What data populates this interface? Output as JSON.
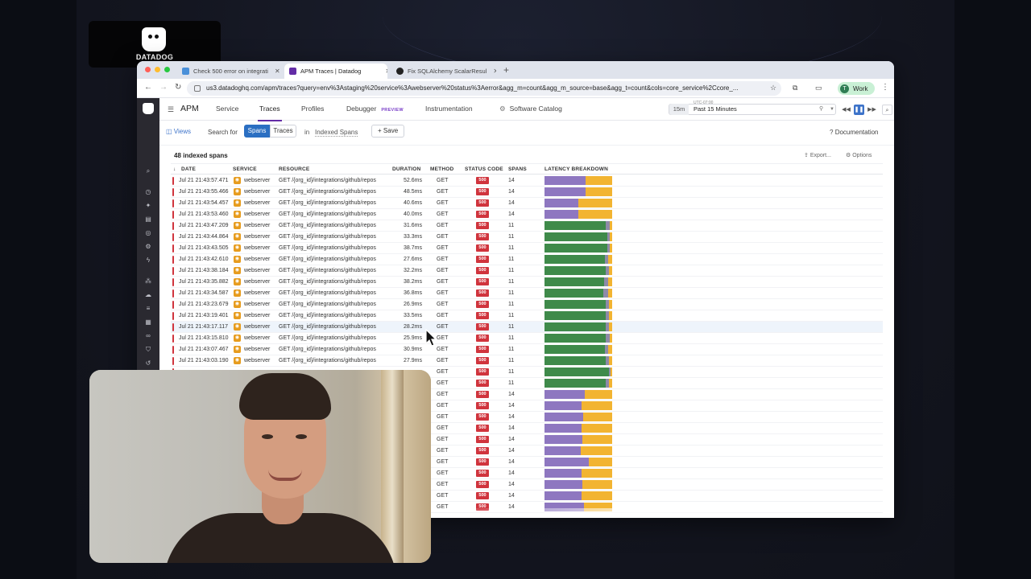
{
  "brand": {
    "logo_text": "DATADOG"
  },
  "browser": {
    "tabs": [
      {
        "title": "Check 500 error on integrati",
        "icon_color": "#4a90d9"
      },
      {
        "title": "APM Traces | Datadog",
        "icon_color": "#632ca6"
      },
      {
        "title": "Fix SQLAlchemy ScalarResul",
        "icon_color": "#222222"
      }
    ],
    "url": "us3.datadoghq.com/apm/traces?query=env%3Astaging%20service%3Awebserver%20status%3Aerror&agg_m=count&agg_m_source=base&agg_t=count&cols=core_service%2Ccore_...",
    "profile_initial": "T",
    "profile_label": "Work"
  },
  "apm": {
    "title": "APM",
    "nav": [
      {
        "label": "Service"
      },
      {
        "label": "Traces"
      },
      {
        "label": "Profiles"
      },
      {
        "label": "Debugger",
        "tag": "PREVIEW"
      },
      {
        "label": "Instrumentation"
      },
      {
        "label": "Software Catalog"
      }
    ],
    "time": {
      "tz": "UTC-07:00",
      "range": "15m",
      "label": "Past 15 Minutes"
    },
    "subbar": {
      "views": "Views",
      "search_for": "Search for",
      "seg_spans": "Spans",
      "seg_traces": "Traces",
      "in": "in",
      "indexed_spans": "Indexed Spans",
      "save": "Save",
      "documentation": "Documentation"
    },
    "count_label": "48 indexed spans",
    "export": "Export...",
    "options": "Options",
    "columns": [
      "DATE",
      "SERVICE",
      "RESOURCE",
      "DURATION",
      "METHOD",
      "STATUS CODE",
      "SPANS",
      "LATENCY BREAKDOWN"
    ],
    "rows": [
      {
        "date": "Jul 21 21:43:57.471",
        "service": "webserver",
        "resource": "GET /{org_id}/integrations/github/repos",
        "duration": "52.6ms",
        "method": "GET",
        "status": "500",
        "spans": "14",
        "latency": [
          0.61,
          0.39,
          0,
          0
        ]
      },
      {
        "date": "Jul 21 21:43:55.466",
        "service": "webserver",
        "resource": "GET /{org_id}/integrations/github/repos",
        "duration": "48.5ms",
        "method": "GET",
        "status": "500",
        "spans": "14",
        "latency": [
          0.61,
          0.39,
          0,
          0
        ]
      },
      {
        "date": "Jul 21 21:43:54.457",
        "service": "webserver",
        "resource": "GET /{org_id}/integrations/github/repos",
        "duration": "40.6ms",
        "method": "GET",
        "status": "500",
        "spans": "14",
        "latency": [
          0.5,
          0.5,
          0,
          0
        ]
      },
      {
        "date": "Jul 21 21:43:53.460",
        "service": "webserver",
        "resource": "GET /{org_id}/integrations/github/repos",
        "duration": "40.0ms",
        "method": "GET",
        "status": "500",
        "spans": "14",
        "latency": [
          0.5,
          0.5,
          0,
          0
        ]
      },
      {
        "date": "Jul 21 21:43:47.209",
        "service": "webserver",
        "resource": "GET /{org_id}/integrations/github/repos",
        "duration": "31.6ms",
        "method": "GET",
        "status": "500",
        "spans": "11",
        "latency": [
          0.91,
          0.05,
          0.04,
          0
        ]
      },
      {
        "date": "Jul 21 21:43:44.864",
        "service": "webserver",
        "resource": "GET /{org_id}/integrations/github/repos",
        "duration": "33.3ms",
        "method": "GET",
        "status": "500",
        "spans": "11",
        "latency": [
          0.93,
          0.04,
          0.03,
          0
        ]
      },
      {
        "date": "Jul 21 21:43:43.505",
        "service": "webserver",
        "resource": "GET /{org_id}/integrations/github/repos",
        "duration": "38.7ms",
        "method": "GET",
        "status": "500",
        "spans": "11",
        "latency": [
          0.93,
          0.04,
          0.03,
          0
        ]
      },
      {
        "date": "Jul 21 21:43:42.610",
        "service": "webserver",
        "resource": "GET /{org_id}/integrations/github/repos",
        "duration": "27.6ms",
        "method": "GET",
        "status": "500",
        "spans": "11",
        "latency": [
          0.89,
          0.05,
          0.06,
          0
        ]
      },
      {
        "date": "Jul 21 21:43:38.184",
        "service": "webserver",
        "resource": "GET /{org_id}/integrations/github/repos",
        "duration": "32.2ms",
        "method": "GET",
        "status": "500",
        "spans": "11",
        "latency": [
          0.9,
          0.05,
          0.05,
          0
        ]
      },
      {
        "date": "Jul 21 21:43:35.882",
        "service": "webserver",
        "resource": "GET /{org_id}/integrations/github/repos",
        "duration": "38.2ms",
        "method": "GET",
        "status": "500",
        "spans": "11",
        "latency": [
          0.88,
          0.06,
          0.06,
          0
        ]
      },
      {
        "date": "Jul 21 21:43:34.587",
        "service": "webserver",
        "resource": "GET /{org_id}/integrations/github/repos",
        "duration": "36.8ms",
        "method": "GET",
        "status": "500",
        "spans": "11",
        "latency": [
          0.87,
          0.07,
          0.06,
          0
        ]
      },
      {
        "date": "Jul 21 21:43:23.679",
        "service": "webserver",
        "resource": "GET /{org_id}/integrations/github/repos",
        "duration": "26.9ms",
        "method": "GET",
        "status": "500",
        "spans": "11",
        "latency": [
          0.9,
          0.05,
          0.05,
          0
        ]
      },
      {
        "date": "Jul 21 21:43:19.401",
        "service": "webserver",
        "resource": "GET /{org_id}/integrations/github/repos",
        "duration": "33.5ms",
        "method": "GET",
        "status": "500",
        "spans": "11",
        "latency": [
          0.9,
          0.05,
          0.05,
          0
        ]
      },
      {
        "date": "Jul 21 21:43:17.117",
        "service": "webserver",
        "resource": "GET /{org_id}/integrations/github/repos",
        "duration": "28.2ms",
        "method": "GET",
        "status": "500",
        "spans": "11",
        "latency": [
          0.9,
          0.05,
          0.05,
          0
        ]
      },
      {
        "date": "Jul 21 21:43:15.810",
        "service": "webserver",
        "resource": "GET /{org_id}/integrations/github/repos",
        "duration": "25.9ms",
        "method": "GET",
        "status": "500",
        "spans": "11",
        "latency": [
          0.91,
          0.05,
          0.04,
          0
        ]
      },
      {
        "date": "Jul 21 21:43:07.467",
        "service": "webserver",
        "resource": "GET /{org_id}/integrations/github/repos",
        "duration": "30.9ms",
        "method": "GET",
        "status": "500",
        "spans": "11",
        "latency": [
          0.89,
          0.05,
          0.06,
          0
        ]
      },
      {
        "date": "Jul 21 21:43:03.190",
        "service": "webserver",
        "resource": "GET /{org_id}/integrations/github/repos",
        "duration": "27.9ms",
        "method": "GET",
        "status": "500",
        "spans": "11",
        "latency": [
          0.9,
          0.05,
          0.05,
          0
        ]
      },
      {
        "method": "GET",
        "status": "500",
        "spans": "11",
        "latency": [
          0.95,
          0.03,
          0.02,
          0
        ]
      },
      {
        "method": "GET",
        "status": "500",
        "spans": "11",
        "latency": [
          0.9,
          0.05,
          0.05,
          0
        ]
      },
      {
        "method": "GET",
        "status": "500",
        "spans": "14",
        "latency": [
          0.6,
          0.4,
          0,
          0
        ]
      },
      {
        "method": "GET",
        "status": "500",
        "spans": "14",
        "latency": [
          0.55,
          0.45,
          0,
          0
        ]
      },
      {
        "method": "GET",
        "status": "500",
        "spans": "14",
        "latency": [
          0.57,
          0.43,
          0,
          0
        ]
      },
      {
        "method": "GET",
        "status": "500",
        "spans": "14",
        "latency": [
          0.55,
          0.45,
          0,
          0
        ]
      },
      {
        "method": "GET",
        "status": "500",
        "spans": "14",
        "latency": [
          0.56,
          0.44,
          0,
          0
        ]
      },
      {
        "method": "GET",
        "status": "500",
        "spans": "14",
        "latency": [
          0.54,
          0.46,
          0,
          0
        ]
      },
      {
        "method": "GET",
        "status": "500",
        "spans": "14",
        "latency": [
          0.65,
          0.35,
          0,
          0
        ]
      },
      {
        "method": "GET",
        "status": "500",
        "spans": "14",
        "latency": [
          0.55,
          0.45,
          0,
          0
        ]
      },
      {
        "method": "GET",
        "status": "500",
        "spans": "14",
        "latency": [
          0.56,
          0.44,
          0,
          0
        ]
      },
      {
        "method": "GET",
        "status": "500",
        "spans": "14",
        "latency": [
          0.55,
          0.45,
          0,
          0
        ]
      },
      {
        "method": "GET",
        "status": "500",
        "spans": "14",
        "latency": [
          0.58,
          0.42,
          0,
          0
        ]
      }
    ],
    "latency_colors": [
      "#8e77c0",
      "#f2b431",
      "#3f8a4a",
      "#8ba3d6"
    ],
    "latency_colors_green": [
      "#3f8a4a",
      "#8e8aa8",
      "#f2b431",
      "#8ba3d6"
    ]
  },
  "colors": {
    "accent": "#632ca6",
    "error": "#d0343d",
    "service_icon": "#e79c1e",
    "spans_button": "#2b6fc2"
  }
}
